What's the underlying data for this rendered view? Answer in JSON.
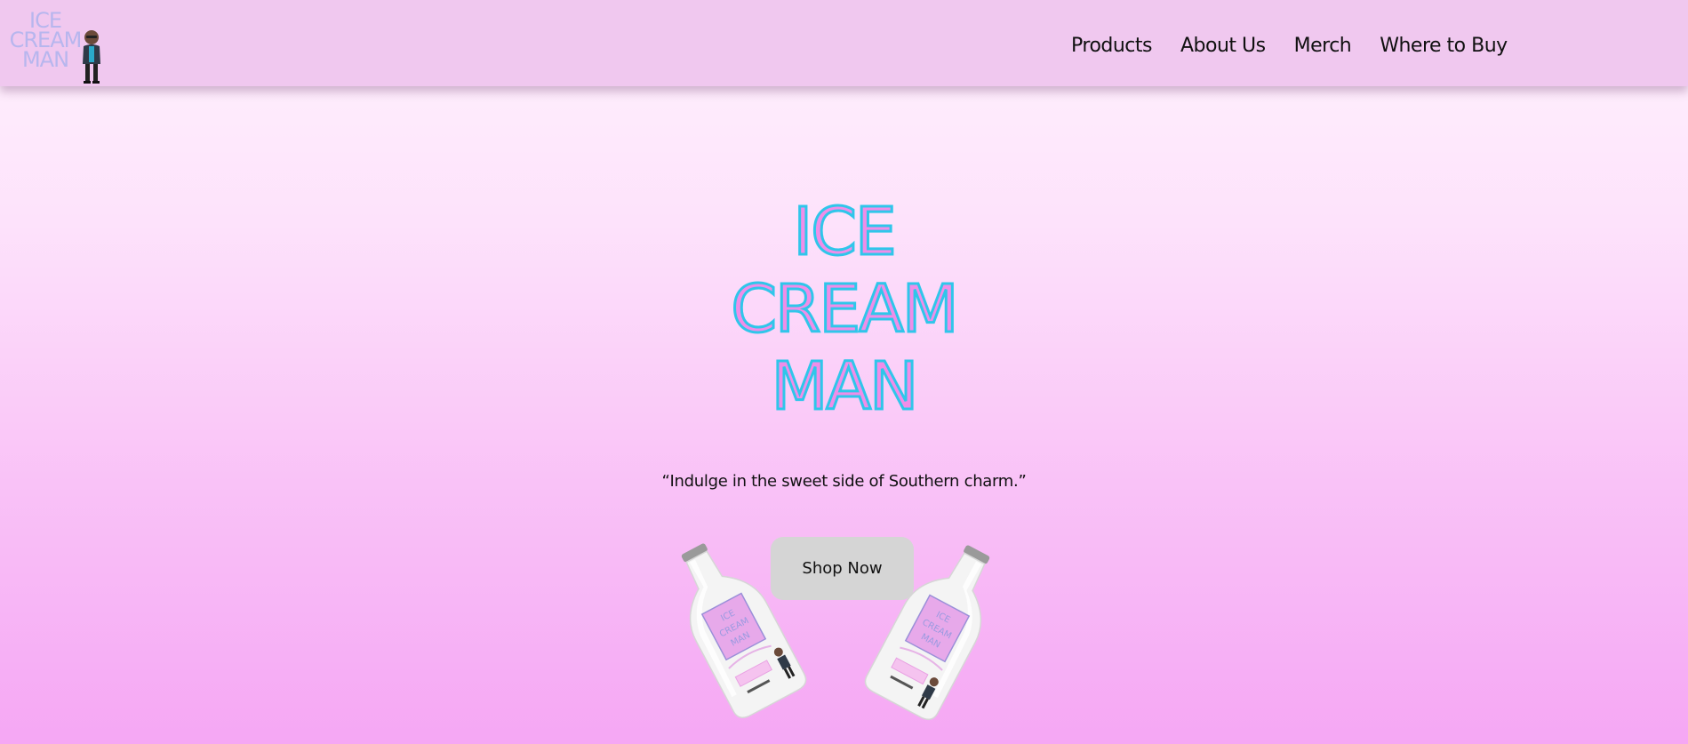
{
  "header": {
    "logo": {
      "lines": [
        "ICE",
        "CREAM",
        "MAN"
      ]
    },
    "nav": [
      {
        "label": "Products"
      },
      {
        "label": "About Us"
      },
      {
        "label": "Merch"
      },
      {
        "label": "Where to Buy"
      }
    ]
  },
  "hero": {
    "title_lines": [
      "ICE",
      "CREAM",
      "MAN"
    ],
    "tagline": "“Indulge in the sweet side of Southern charm.”",
    "cta_label": "Shop Now",
    "bottle_label_lines": [
      "ICE",
      "CREAM",
      "MAN"
    ]
  },
  "colors": {
    "header_bg": "#f0c8ef",
    "title_fill": "#f08de8",
    "title_stroke": "#2fc6ea",
    "logo_text": "#b7b6ee",
    "button_bg": "#d5d5d5"
  }
}
